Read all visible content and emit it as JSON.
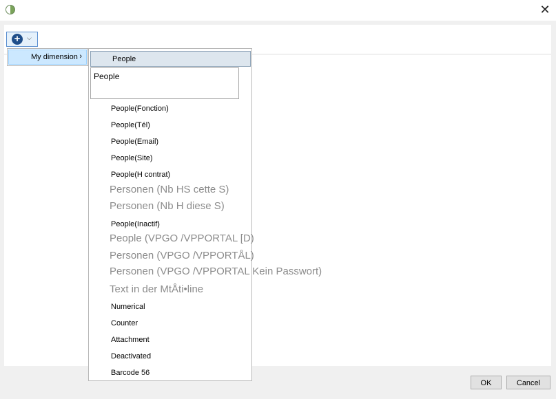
{
  "window": {
    "close_glyph": "✕"
  },
  "toolbar": {
    "add_icon": "plus-circle-icon",
    "plus_glyph": "+",
    "chevron_glyph": "⌵"
  },
  "menu": {
    "parent_label": "My dimension",
    "parent_arrow": "›",
    "highlighted": "People",
    "tooltip": "People",
    "items": [
      {
        "label": "People(Fonction)",
        "style": "normal"
      },
      {
        "label": "People(Tél)",
        "style": "normal"
      },
      {
        "label": "People(Email)",
        "style": "normal"
      },
      {
        "label": "People(Site)",
        "style": "normal"
      },
      {
        "label": "People(H contrat)",
        "style": "normal"
      },
      {
        "label": "Personen (Nb HS cette S)",
        "style": "large"
      },
      {
        "label": "Personen (Nb H diese S)",
        "style": "large"
      },
      {
        "label": "People(Inactif)",
        "style": "normal"
      },
      {
        "label": "People (VPGO /VPPORTAL [D)",
        "style": "large"
      },
      {
        "label": "Personen (VPGO /VPPORTÅL)",
        "style": "large"
      },
      {
        "label": "Personen (VPGO /VPPORTAL Kein Passwort)",
        "style": "large"
      },
      {
        "label": "Text in der MtÅti•line",
        "style": "large"
      },
      {
        "label": "Numerical",
        "style": "normal"
      },
      {
        "label": "Counter",
        "style": "normal"
      },
      {
        "label": "Attachment",
        "style": "normal"
      },
      {
        "label": "Deactivated",
        "style": "normal"
      },
      {
        "label": "Barcode 56",
        "style": "normal"
      }
    ]
  },
  "buttons": {
    "ok": "OK",
    "cancel": "Cancel"
  },
  "colors": {
    "highlight": "#cce8ff",
    "accent": "#1f4e8a",
    "muted_text": "#8c8c8c"
  }
}
